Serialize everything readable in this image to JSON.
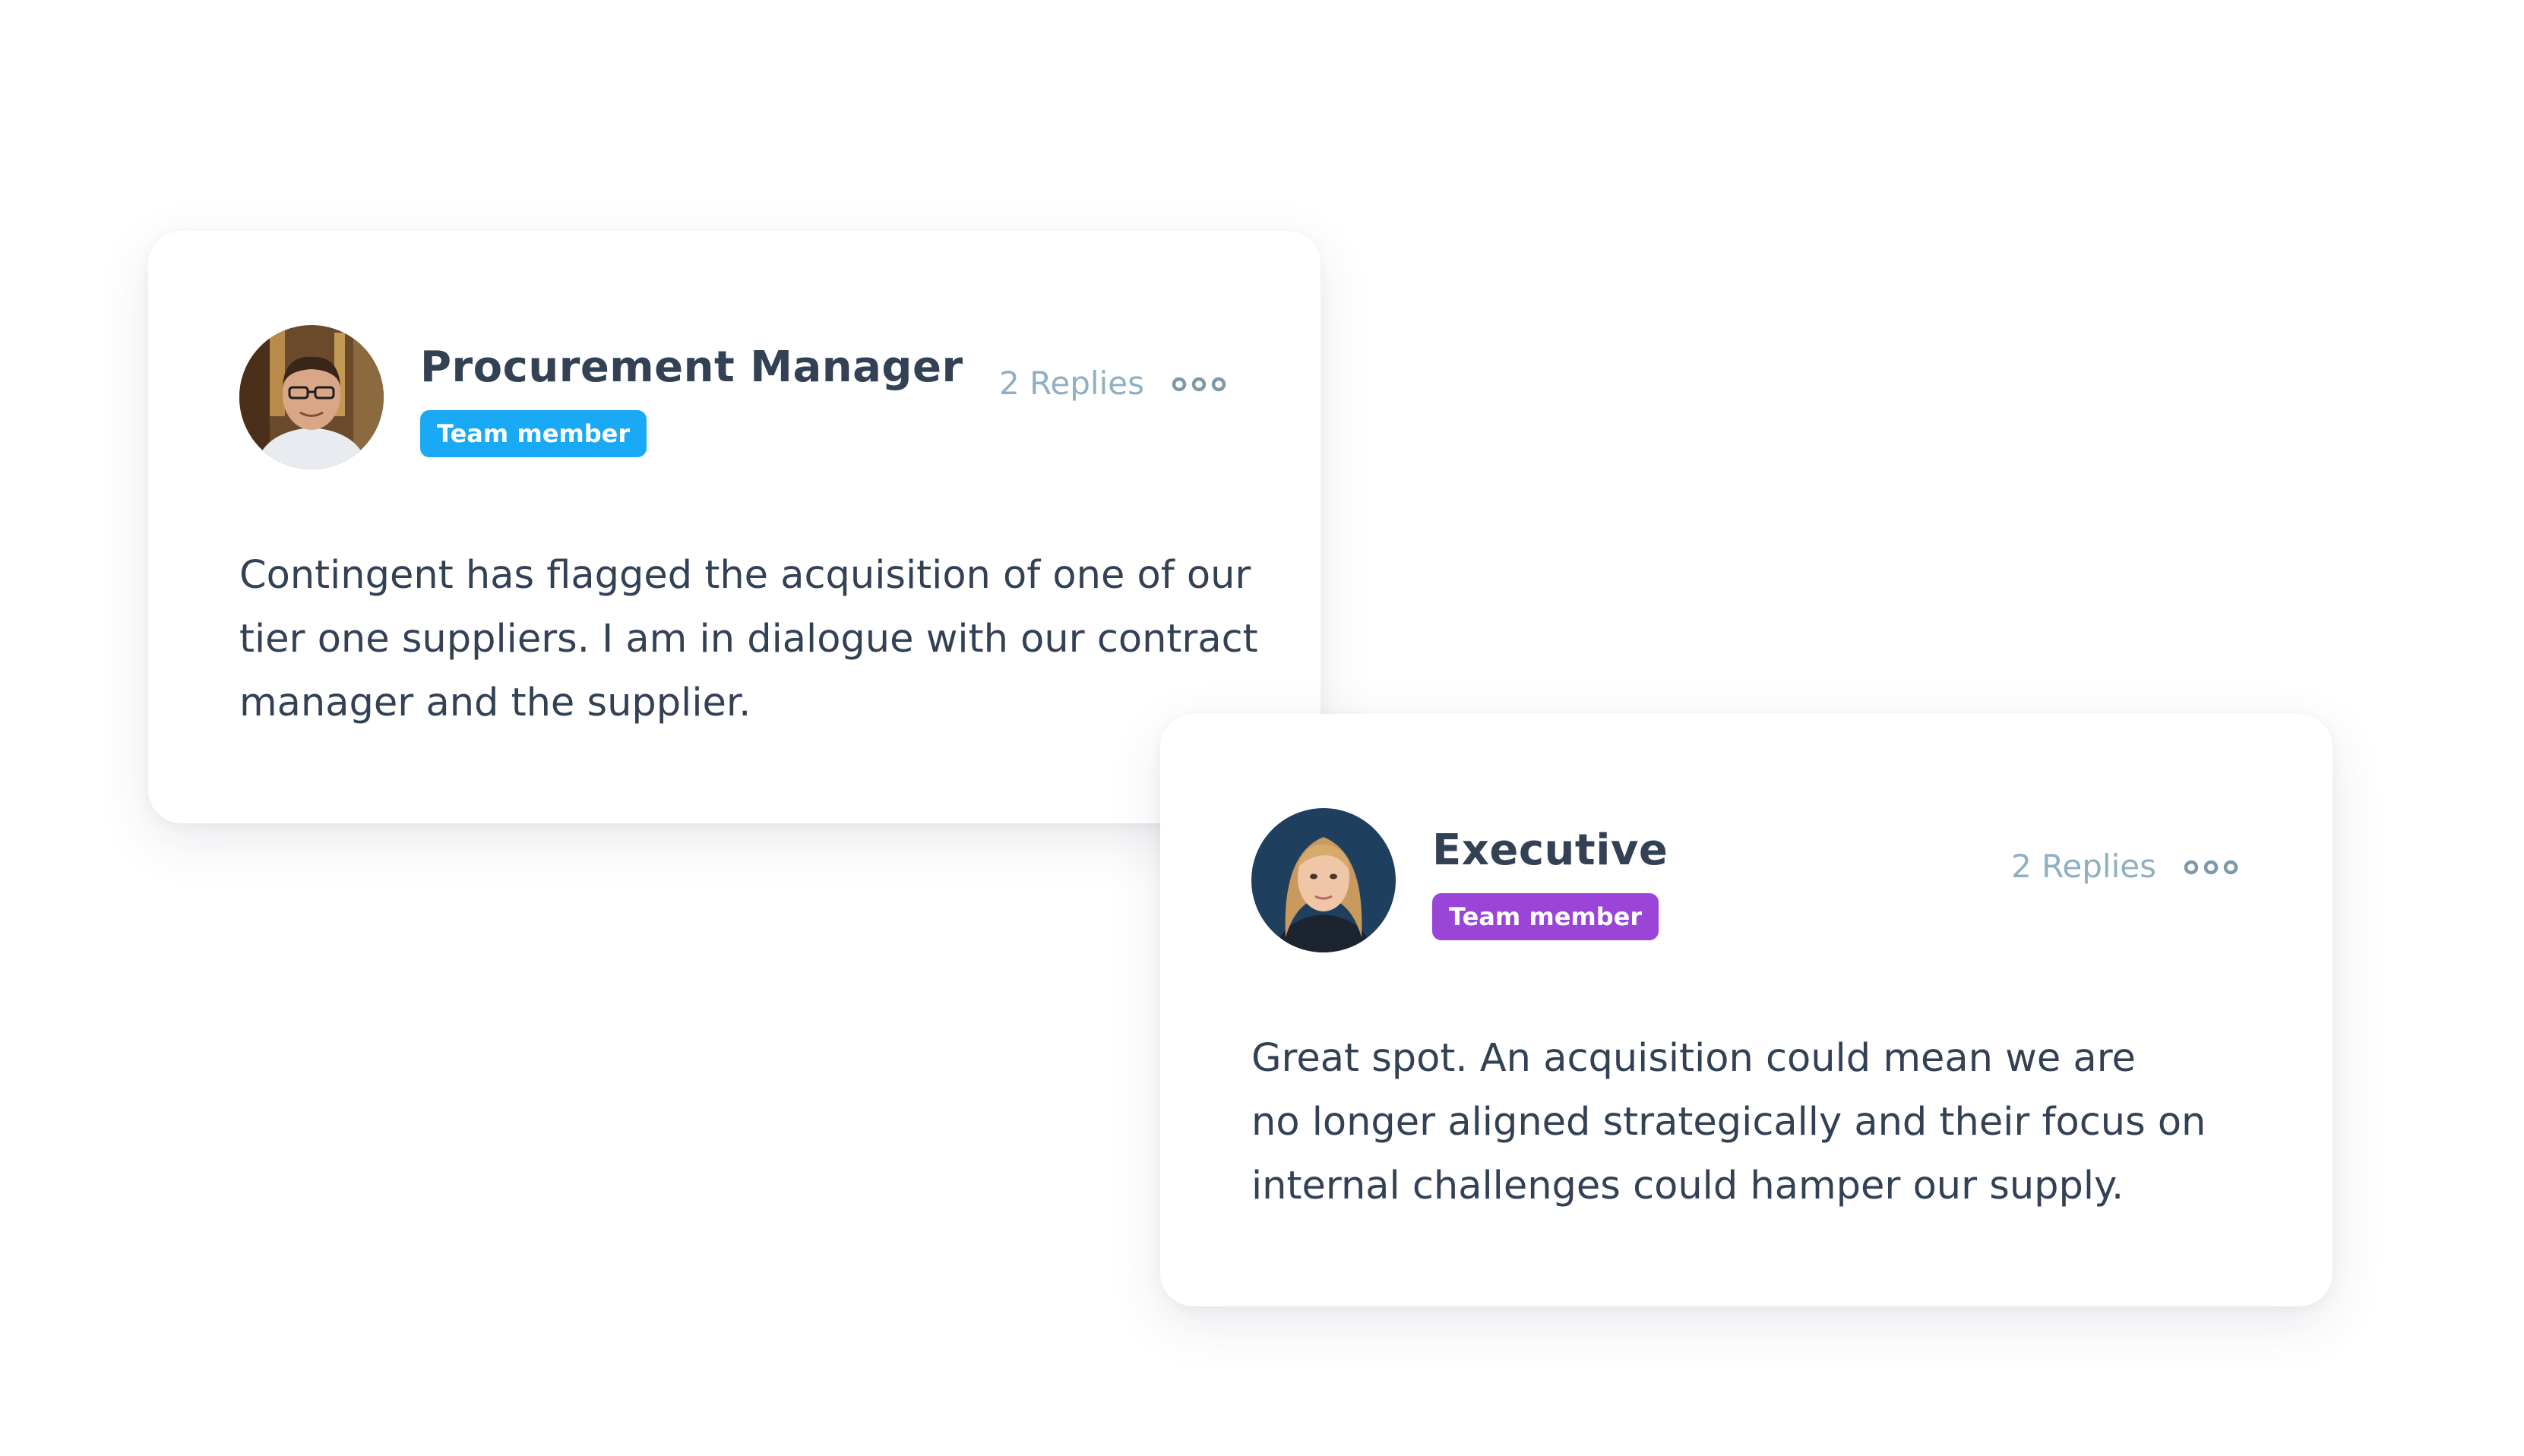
{
  "comments": [
    {
      "author": "Procurement Manager",
      "role": "Team member",
      "role_color": "#1aa9f5",
      "replies": "2 Replies",
      "avatar_icon": "man-portrait-avatar",
      "text_lines": [
        "Contingent has flagged the acquisition of one of our",
        "tier one suppliers. I am in dialogue with our contract",
        "manager and the supplier."
      ]
    },
    {
      "author": "Executive",
      "role": "Team member",
      "role_color": "#9a44d8",
      "replies": "2 Replies",
      "avatar_icon": "woman-portrait-avatar",
      "text_lines": [
        "Great spot. An acquisition could mean we are",
        "no longer aligned strategically and their focus on",
        "internal challenges could hamper our supply."
      ]
    }
  ],
  "colors": {
    "name_text": "#334155",
    "replies_text": "#8fb0c2",
    "more_icon": "#7d98a8",
    "card_background": "#ffffff"
  }
}
